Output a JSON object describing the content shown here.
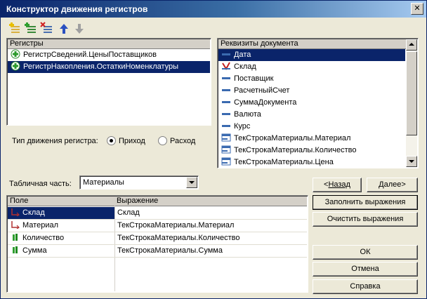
{
  "window": {
    "title": "Конструктор движения регистров"
  },
  "icons": {
    "close": "close-icon",
    "add_register": "add-register-icon",
    "add_all": "add-all-registers-icon",
    "delete": "delete-register-icon",
    "move_up": "arrow-up-icon",
    "move_down": "arrow-down-icon"
  },
  "registers": {
    "header": "Регистры",
    "items": [
      {
        "label": "РегистрСведений.ЦеныПоставщиков",
        "selected": false
      },
      {
        "label": "РегистрНакопления.ОстаткиНоменклатуры",
        "selected": true
      }
    ]
  },
  "movement_type": {
    "label": "Тип движения регистра:",
    "options": [
      "Приход",
      "Расход"
    ],
    "selected": "Приход"
  },
  "attributes": {
    "header": "Реквизиты документа",
    "items": [
      {
        "label": "Дата",
        "icon": "attribute-icon",
        "selected": true
      },
      {
        "label": "Склад",
        "icon": "attribute-link-icon",
        "selected": false
      },
      {
        "label": "Поставщик",
        "icon": "attribute-icon",
        "selected": false
      },
      {
        "label": "РасчетныйСчет",
        "icon": "attribute-icon",
        "selected": false
      },
      {
        "label": "СуммаДокумента",
        "icon": "attribute-icon",
        "selected": false
      },
      {
        "label": "Валюта",
        "icon": "attribute-icon",
        "selected": false
      },
      {
        "label": "Курс",
        "icon": "attribute-icon",
        "selected": false
      },
      {
        "label": "ТекСтрокаМатериалы.Материал",
        "icon": "table-attribute-icon",
        "selected": false
      },
      {
        "label": "ТекСтрокаМатериалы.Количество",
        "icon": "table-attribute-icon",
        "selected": false
      },
      {
        "label": "ТекСтрокаМатериалы.Цена",
        "icon": "table-attribute-icon",
        "selected": false
      }
    ]
  },
  "tabular_section": {
    "label": "Табличная часть:",
    "value": "Материалы"
  },
  "nav": {
    "back": "Назад",
    "back_prefix": "<",
    "next": "Далее>"
  },
  "fill_button": "Заполнить выражения",
  "clear_button": "Очистить выражения",
  "ok_button": "ОК",
  "cancel_button": "Отмена",
  "help_button": "Справка",
  "grid": {
    "columns": [
      "Поле",
      "Выражение"
    ],
    "rows": [
      {
        "field": "Склад",
        "expression": "Склад",
        "icon": "dimension-icon",
        "selected": true
      },
      {
        "field": "Материал",
        "expression": "ТекСтрокаМатериалы.Материал",
        "icon": "dimension-icon",
        "selected": false
      },
      {
        "field": "Количество",
        "expression": "ТекСтрокаМатериалы.Количество",
        "icon": "resource-icon",
        "selected": false
      },
      {
        "field": "Сумма",
        "expression": "ТекСтрокаМатериалы.Сумма",
        "icon": "resource-icon",
        "selected": false
      }
    ]
  },
  "colors": {
    "selection": "#0a246a",
    "title_start": "#0a246a",
    "title_end": "#a6caf0",
    "face": "#ece9d8"
  }
}
